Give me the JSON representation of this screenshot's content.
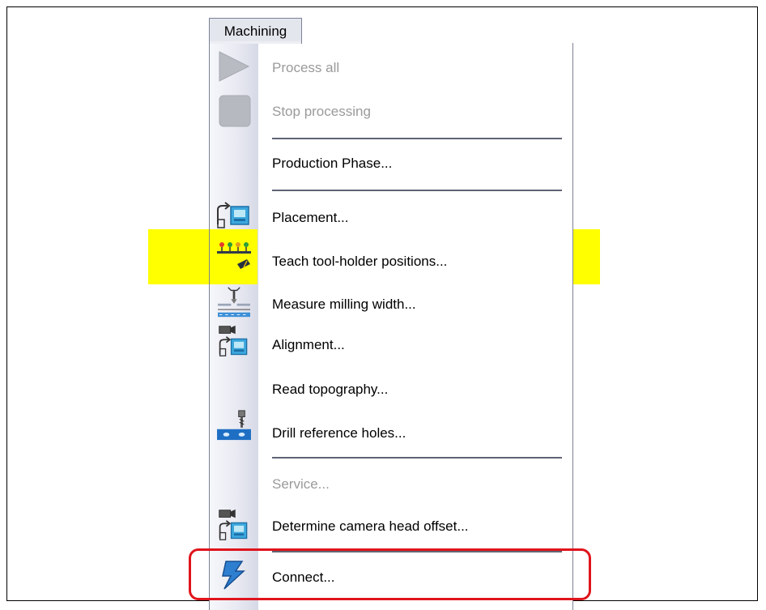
{
  "menu": {
    "title": "Machining",
    "items": [
      {
        "label": "Process all",
        "enabled": false,
        "icon": "play-icon"
      },
      {
        "label": "Stop processing",
        "enabled": false,
        "icon": "stop-icon"
      },
      {
        "label": "Production Phase...",
        "enabled": true,
        "icon": ""
      },
      {
        "label": "Placement...",
        "enabled": true,
        "icon": "placement-icon"
      },
      {
        "label": "Teach tool-holder positions...",
        "enabled": true,
        "icon": "tool-holder-teach-icon",
        "highlighted": true
      },
      {
        "label": "Measure milling width...",
        "enabled": true,
        "icon": "milling-width-icon"
      },
      {
        "label": "Alignment...",
        "enabled": true,
        "icon": "alignment-camera-icon"
      },
      {
        "label": "Read topography...",
        "enabled": true,
        "icon": ""
      },
      {
        "label": "Drill reference holes...",
        "enabled": true,
        "icon": "drill-icon"
      },
      {
        "label": "Service...",
        "enabled": false,
        "icon": ""
      },
      {
        "label": "Determine camera head offset...",
        "enabled": true,
        "icon": "camera-offset-icon"
      },
      {
        "label": "Connect...",
        "enabled": true,
        "icon": "lightning-icon",
        "outlined": true
      }
    ]
  },
  "colors": {
    "highlight": "#ffff00",
    "outline": "#e0141c",
    "disabled_text": "#9a9a9a"
  }
}
